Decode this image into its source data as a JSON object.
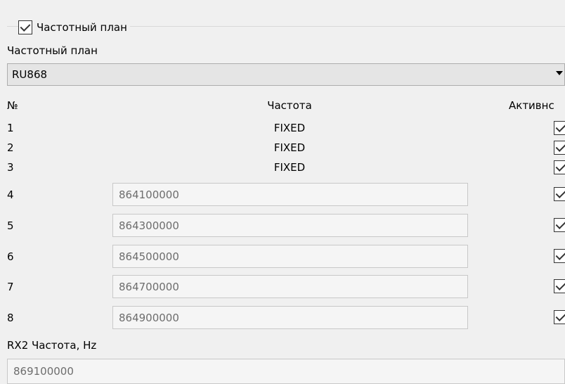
{
  "group": {
    "label": "Частотный план",
    "checked": true
  },
  "plan_label": "Частотный план",
  "plan_select": {
    "value": "RU868"
  },
  "table": {
    "headers": {
      "num": "№",
      "freq": "Частота",
      "active": "Активнс"
    },
    "fixed_rows": [
      {
        "num": "1",
        "freq": "FIXED",
        "active": true
      },
      {
        "num": "2",
        "freq": "FIXED",
        "active": true
      },
      {
        "num": "3",
        "freq": "FIXED",
        "active": true
      }
    ],
    "editable_rows": [
      {
        "num": "4",
        "freq": "864100000",
        "active": true
      },
      {
        "num": "5",
        "freq": "864300000",
        "active": true
      },
      {
        "num": "6",
        "freq": "864500000",
        "active": true
      },
      {
        "num": "7",
        "freq": "864700000",
        "active": true
      },
      {
        "num": "8",
        "freq": "864900000",
        "active": true
      }
    ]
  },
  "rx2": {
    "label": "RX2 Частота, Hz",
    "value": "869100000"
  }
}
